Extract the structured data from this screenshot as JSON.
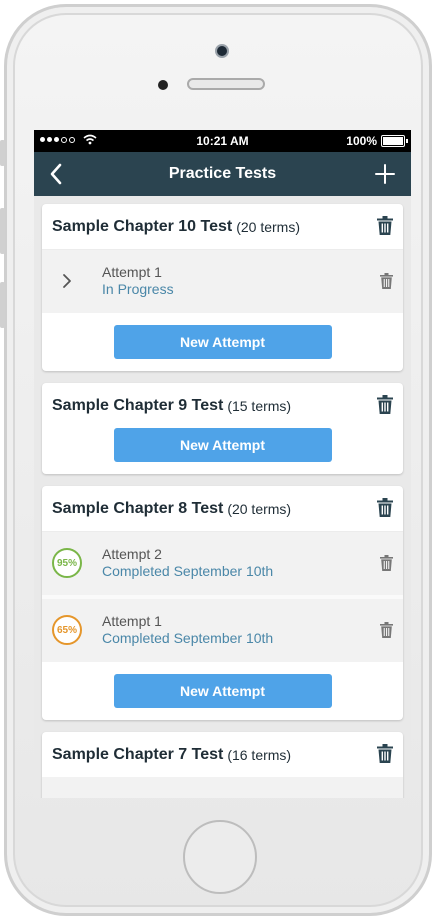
{
  "status_bar": {
    "time": "10:21 AM",
    "battery": "100%"
  },
  "nav": {
    "title": "Practice Tests",
    "back_icon": "chevron-left-icon",
    "add_icon": "plus-icon"
  },
  "colors": {
    "nav_bg": "#2b4450",
    "button": "#4fa3e8",
    "link": "#4a87a8",
    "score_green": "#7ab648",
    "score_orange": "#e5962b"
  },
  "tests": [
    {
      "title": "Sample Chapter 10 Test",
      "terms": "(20 terms)",
      "attempts": [
        {
          "name": "Attempt 1",
          "status": "In Progress"
        }
      ],
      "button_label": "New Attempt"
    },
    {
      "title": "Sample Chapter 9 Test",
      "terms": "(15 terms)",
      "attempts": [],
      "button_label": "New Attempt"
    },
    {
      "title": "Sample Chapter 8 Test",
      "terms": "(20 terms)",
      "attempts": [
        {
          "score": "95%",
          "name": "Attempt 2",
          "status": "Completed September 10th"
        },
        {
          "score": "65%",
          "name": "Attempt 1",
          "status": "Completed September 10th"
        }
      ],
      "button_label": "New Attempt"
    },
    {
      "title": "Sample Chapter 7 Test",
      "terms": "(16 terms)",
      "attempts": [],
      "button_label": ""
    }
  ]
}
